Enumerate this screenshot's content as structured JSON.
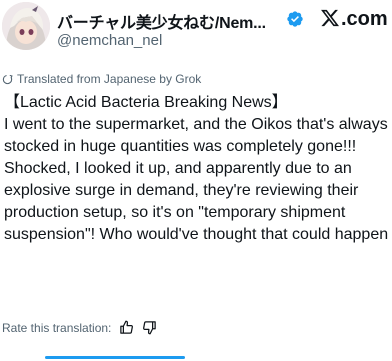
{
  "tweet": {
    "display_name": "バーチャル美少女ねむ/Nem...",
    "handle": "@nemchan_nel",
    "platform_logo": ".com",
    "translated_label": "Translated from Japanese by Grok",
    "headline": "【Lactic Acid Bacteria Breaking News】",
    "body": "I went to the supermarket, and the Oikos that's always stocked in huge quantities was completely gone!!! Shocked, I looked it up, and apparently due to an explosive surge in demand, they're reviewing their production setup, so it's on \"temporary shipment suspension\"! Who would've thought that could happen",
    "rate_label": "Rate this translation:"
  },
  "icons": {
    "verified": "verified-badge-icon",
    "x": "x-logo-icon",
    "translate": "translate-icon",
    "thumbs_up": "thumbs-up-icon",
    "thumbs_down": "thumbs-down-icon"
  },
  "colors": {
    "verified": "#1d9bf0",
    "secondary_text": "#536471",
    "text": "#0f1419"
  }
}
